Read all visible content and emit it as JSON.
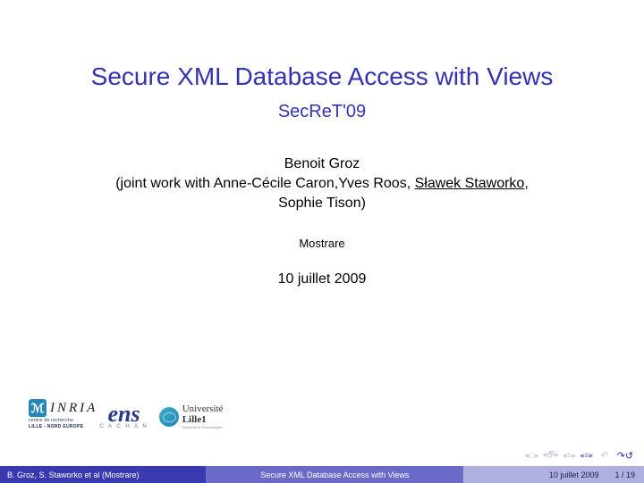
{
  "title": "Secure XML Database Access with Views",
  "subtitle": "SecReT'09",
  "author": "Benoit Groz",
  "collab_prefix": "(joint work with Anne-Cécile Caron,Yves Roos, ",
  "collab_underlined": "Sławek Staworko",
  "collab_suffix": ",",
  "collab_line2": "Sophie Tison)",
  "institute": "Mostrare",
  "date": "10 juillet 2009",
  "logos": {
    "inria": {
      "glyph": "ℳ",
      "name": "INRIA",
      "tagline": "LILLE - NORD EUROPE",
      "centre": "centre de recherche"
    },
    "ens": {
      "name": "ens",
      "sub": "C A C H A N"
    },
    "lille": {
      "top": "Université",
      "bot": "Lille1",
      "sub": "Sciences et Technologies"
    }
  },
  "nav": {
    "first": "◂ □ ▸",
    "prev": "◂ 🗗 ▸",
    "next": "◂ ≡ ▸",
    "last": "◂ ≡ ▸",
    "back_arrows": "↶",
    "redo_arrows": "↷↺"
  },
  "footer": {
    "left": "B. Groz, S. Staworko et al  (Mostrare)",
    "mid": "Secure XML Database Access with Views",
    "date": "10 juillet 2009",
    "page": "1 / 19"
  }
}
